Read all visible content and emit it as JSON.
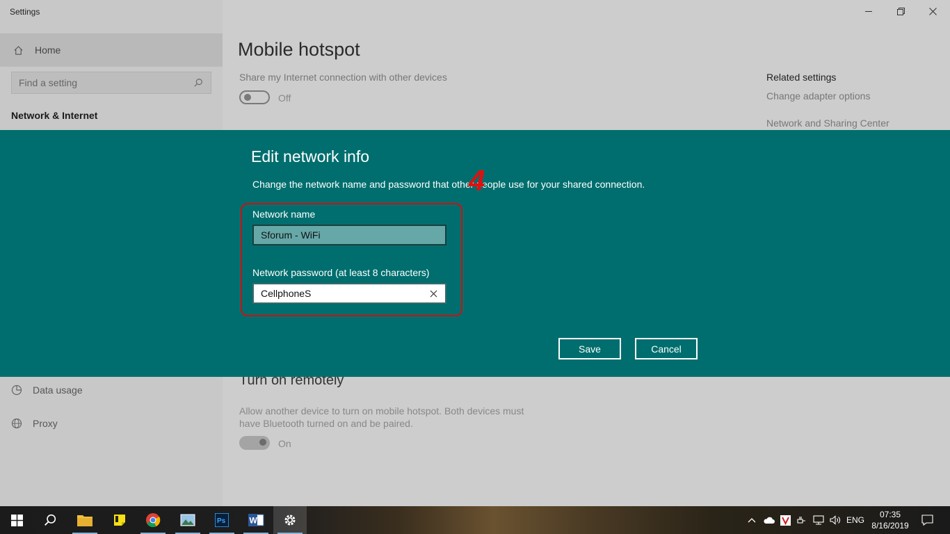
{
  "window": {
    "title": "Settings"
  },
  "sidebar": {
    "home_label": "Home",
    "search_placeholder": "Find a setting",
    "section_title": "Network & Internet",
    "items": [
      {
        "label": "Data usage",
        "icon": "data-usage-icon"
      },
      {
        "label": "Proxy",
        "icon": "globe-icon"
      }
    ]
  },
  "main": {
    "page_title": "Mobile hotspot",
    "share_label": "Share my Internet connection with other devices",
    "share_toggle_state": "Off",
    "related_title": "Related settings",
    "related_links": [
      "Change adapter options",
      "Network and Sharing Center"
    ],
    "remote_title": "Turn on remotely",
    "remote_desc": "Allow another device to turn on mobile hotspot. Both devices must have Bluetooth turned on and be paired.",
    "remote_toggle_state": "On"
  },
  "dialog": {
    "title": "Edit network info",
    "description": "Change the network name and password that other people use for your shared connection.",
    "annotation_number": "4",
    "name_label": "Network name",
    "name_value": "Sforum - WiFi",
    "password_label": "Network password (at least 8 characters)",
    "password_value": "CellphoneS",
    "save_label": "Save",
    "cancel_label": "Cancel",
    "accent_color": "#006e6e",
    "annotation_color": "#d01010"
  },
  "taskbar": {
    "apps": [
      "start-icon",
      "search-icon",
      "file-explorer-icon",
      "sticky-notes-icon",
      "chrome-icon",
      "photos-icon",
      "photoshop-icon",
      "word-icon",
      "settings-icon"
    ],
    "language": "ENG",
    "time": "07:35",
    "date": "8/16/2019"
  }
}
